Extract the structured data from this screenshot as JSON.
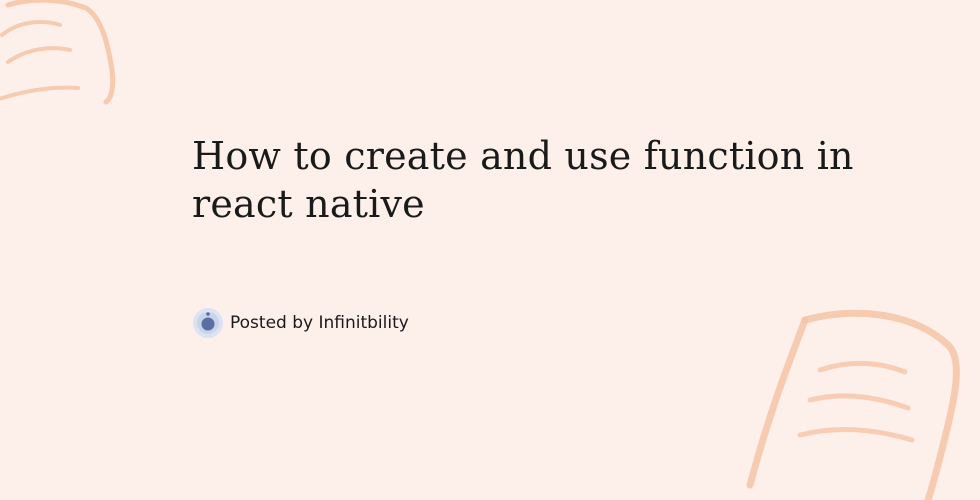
{
  "post": {
    "title": "How to create and use function in react native",
    "byline": "Posted by Infinitbility"
  },
  "icons": {
    "avatar": "infinitbility-logo-icon"
  },
  "colors": {
    "background": "#fdf0ea",
    "doodle": "#f6c4a6",
    "text": "#1a1a1a",
    "avatar_ring": "#c9d3ea",
    "avatar_core": "#5a6fa3"
  }
}
